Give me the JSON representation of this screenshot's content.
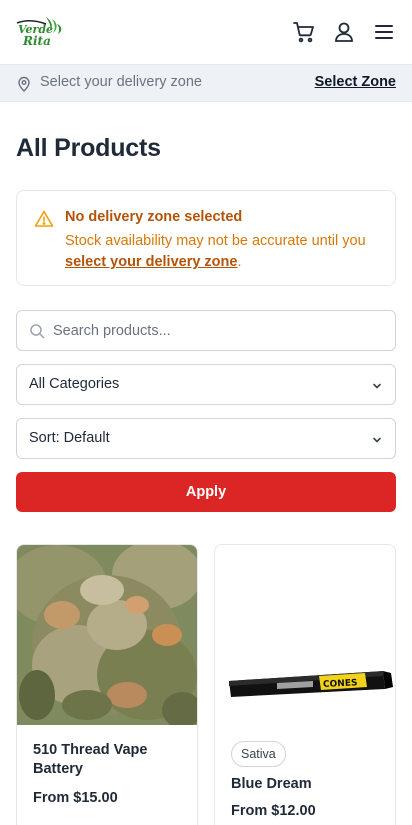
{
  "header": {
    "logo_text": "Verde Rita",
    "icons": [
      "cart-icon",
      "user-icon",
      "menu-icon"
    ]
  },
  "delivery": {
    "prompt": "Select your delivery zone",
    "link": "Select Zone"
  },
  "page": {
    "title": "All Products"
  },
  "alert": {
    "title": "No delivery zone selected",
    "body_prefix": "Stock availability may not be accurate until you ",
    "body_link": "select your delivery zone",
    "body_suffix": "."
  },
  "filters": {
    "search_placeholder": "Search products...",
    "category": "All Categories",
    "sort": "Sort: Default",
    "apply": "Apply"
  },
  "products": [
    {
      "name": "510 Thread Vape Battery",
      "price": "From $15.00",
      "badge": ""
    },
    {
      "name": "Blue Dream",
      "price": "From $12.00",
      "badge": "Sativa"
    }
  ],
  "colors": {
    "accent": "#dc2626",
    "warning_text": "#d97706",
    "warning_title": "#b45309",
    "logo_green": "#2e8b2e"
  }
}
